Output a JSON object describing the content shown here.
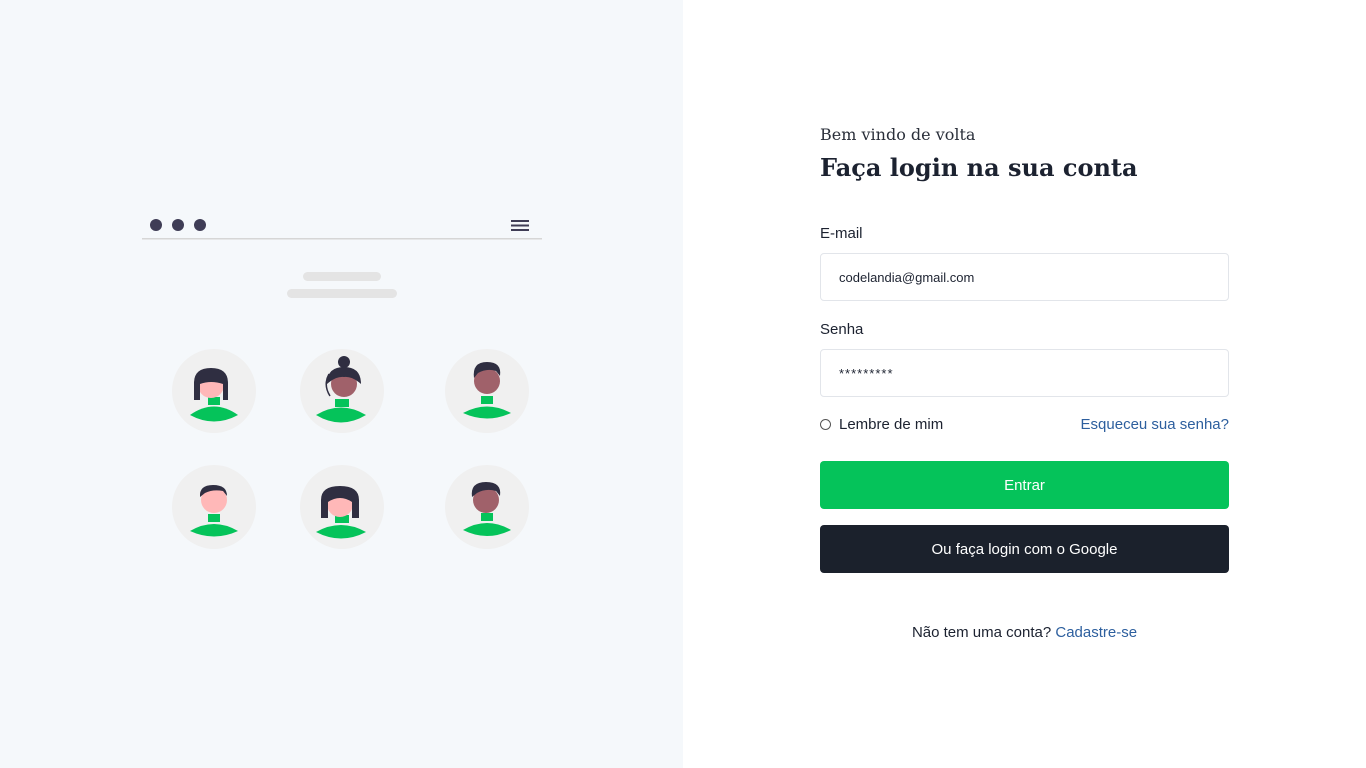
{
  "illustration": {
    "description_icons": [
      "window-dots-icon",
      "hamburger-menu-icon",
      "avatar-icon"
    ],
    "colors": {
      "accent": "#05c35a",
      "dark": "#3f3d56",
      "circle": "#f0f0f0"
    }
  },
  "login": {
    "welcome": "Bem vindo de volta",
    "title": "Faça login na sua conta",
    "email_label": "E-mail",
    "email_value": "codelandia@gmail.com",
    "password_label": "Senha",
    "password_value": "*********",
    "remember_label": "Lembre de mim",
    "forgot_link": "Esqueceu sua senha?",
    "enter_button": "Entrar",
    "google_button": "Ou faça login com o Google",
    "signup_prompt": "Não tem uma conta?",
    "signup_link": "Cadastre-se"
  },
  "colors": {
    "primary": "#05c35a",
    "dark_button": "#1b212c",
    "link": "#2d5f9e",
    "left_bg": "#f5f8fb"
  }
}
